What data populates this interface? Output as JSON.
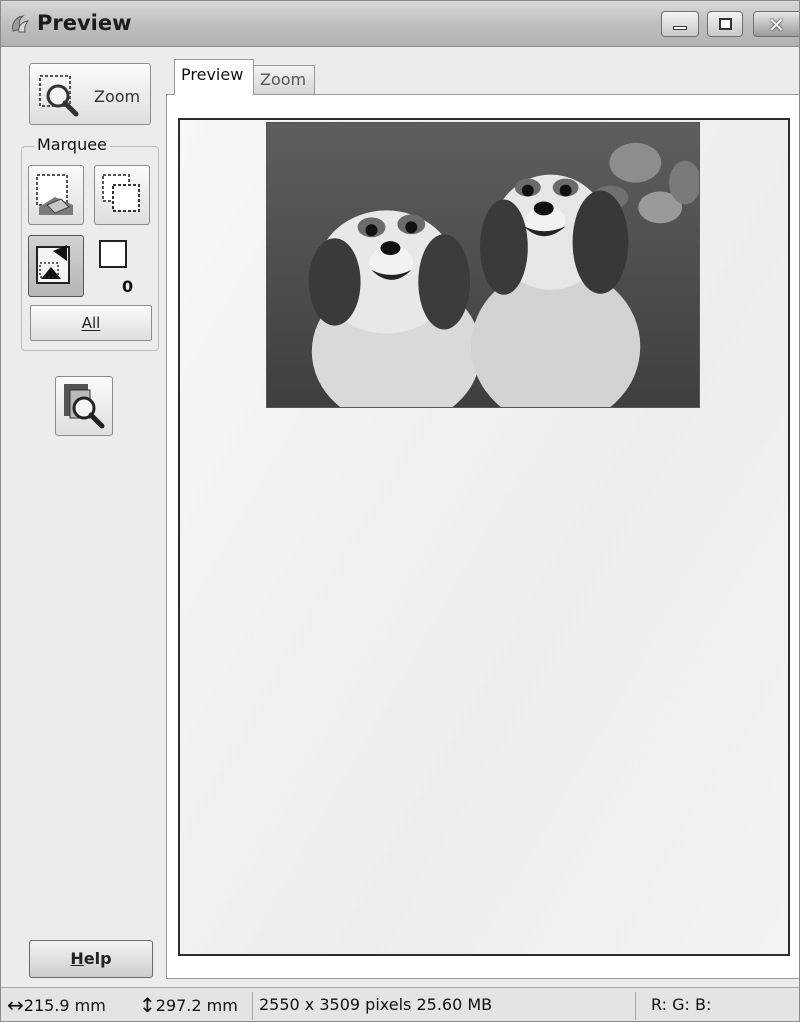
{
  "window": {
    "title": "Preview"
  },
  "titlebar": {
    "icons": [
      "app-icon",
      "minimize-icon",
      "maximize-icon",
      "close-icon"
    ]
  },
  "toolbar": {
    "zoom_label": "Zoom",
    "marquee_title": "Marquee",
    "marquee_count": "0",
    "all_label": "All",
    "help_prefix": "H",
    "help_rest": "elp"
  },
  "tabs": [
    {
      "label": "Preview",
      "active": true
    },
    {
      "label": "Zoom",
      "active": false
    }
  ],
  "status": {
    "width": "215.9 mm",
    "height": "297.2 mm",
    "pixels": "2550 x 3509 pixels 25.60 MB",
    "rgb": "R: G: B:"
  }
}
